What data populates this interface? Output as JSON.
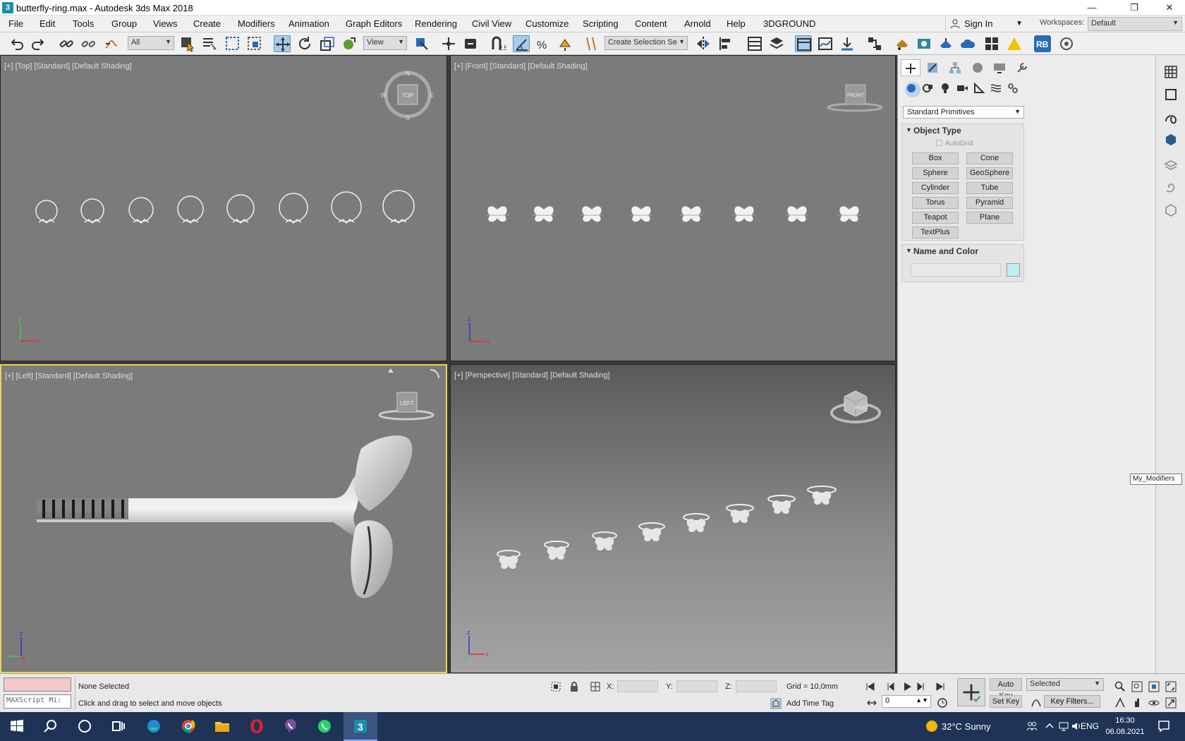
{
  "window": {
    "title": "butterfly-ring.max - Autodesk 3ds Max 2018",
    "app_icon": "3",
    "controls": [
      "minimize-icon",
      "restore-icon",
      "close-icon"
    ]
  },
  "menu": [
    "File",
    "Edit",
    "Tools",
    "Group",
    "Views",
    "Create",
    "Modifiers",
    "Animation",
    "Graph Editors",
    "Rendering",
    "Civil View",
    "Customize",
    "Scripting",
    "Content",
    "Arnold",
    "Help",
    "3DGROUND"
  ],
  "account": {
    "sign_in": "Sign In",
    "workspaces_label": "Workspaces:",
    "workspace": "Default"
  },
  "toolbar": {
    "selection_filter": "All",
    "ref_coord": "View",
    "named_selection": "Create Selection Se",
    "snap_label": "2.5",
    "rb_badge": "RB"
  },
  "viewports": {
    "top": "[+] [Top] [Standard] [Default Shading]",
    "front": "[+] [Front] [Standard] [Default Shading]",
    "left": "[+] [Left] [Standard] [Default Shading]",
    "persp": "[+] [Perspective] [Standard] [Default Shading]",
    "cube_top": "TOP",
    "cube_front": "FRONT",
    "cube_left": "LEFT",
    "compass": [
      "N",
      "S",
      "W",
      "E"
    ],
    "axis": [
      "x",
      "y",
      "z"
    ]
  },
  "command_panel": {
    "primitive_type": "Standard Primitives",
    "object_type": "Object Type",
    "autogrid": "AutoGrid",
    "buttons": [
      "Box",
      "Cone",
      "Sphere",
      "GeoSphere",
      "Cylinder",
      "Tube",
      "Torus",
      "Pyramid",
      "Teapot",
      "Plane",
      "TextPlus"
    ],
    "name_and_color": "Name and Color",
    "swatch_color": "#bfeef5"
  },
  "tooltip": "My_Modifiers",
  "status": {
    "maxscript": "MAXScript Mi:",
    "selection": "None Selected",
    "prompt": "Click and drag to select and move objects",
    "x_label": "X:",
    "y_label": "Y:",
    "z_label": "Z:",
    "grid": "Grid = 10,0mm",
    "add_time_tag": "Add Time Tag",
    "auto_key": "Auto Key",
    "set_key": "Set Key",
    "key_mode": "Selected",
    "frame": "0",
    "key_filters": "Key Filters..."
  },
  "taskbar": {
    "weather": "32°C  Sunny",
    "lang": "ENG",
    "time": "16:30",
    "date": "06.08.2021"
  }
}
